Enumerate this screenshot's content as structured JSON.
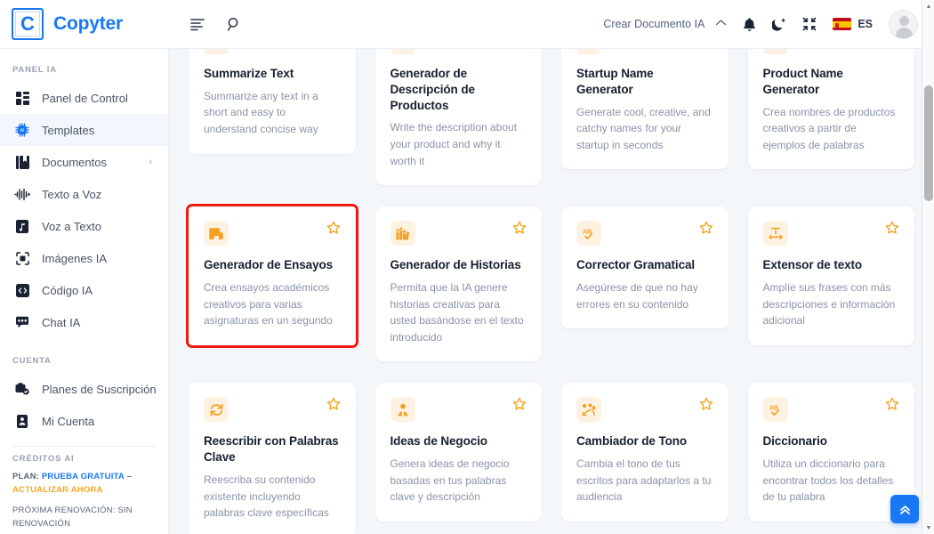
{
  "header": {
    "logo_letter": "C",
    "brand_name": "Copyter",
    "menu_icon": "list-icon",
    "search_icon": "search-icon",
    "create_document_label": "Crear Documento IA",
    "caret": "⌃",
    "notification_icon": "bell-icon",
    "theme_icon": "moon-icon",
    "fullscreen_icon": "fullscreen-icon",
    "lang_code": "ES",
    "avatar_label": "user-avatar"
  },
  "sidebar": {
    "section_panel": "PANEL IA",
    "items": [
      {
        "label": "Panel de Control",
        "icon": "dashboard-icon",
        "active": false,
        "chevron": ""
      },
      {
        "label": "Templates",
        "icon": "ai-chip-icon",
        "active": true,
        "chevron": ""
      },
      {
        "label": "Documentos",
        "icon": "document-icon",
        "active": false,
        "chevron": "›"
      },
      {
        "label": "Texto a Voz",
        "icon": "waveform-icon",
        "active": false,
        "chevron": ""
      },
      {
        "label": "Voz a Texto",
        "icon": "audio-file-icon",
        "active": false,
        "chevron": ""
      },
      {
        "label": "Imágenes IA",
        "icon": "image-scan-icon",
        "active": false,
        "chevron": ""
      },
      {
        "label": "Código IA",
        "icon": "code-icon",
        "active": false,
        "chevron": ""
      },
      {
        "label": "Chat IA",
        "icon": "chat-icon",
        "active": false,
        "chevron": ""
      }
    ],
    "section_account": "CUENTA",
    "account_items": [
      {
        "label": "Planes de Suscripción",
        "icon": "subscription-icon"
      },
      {
        "label": "Mi Cuenta",
        "icon": "account-card-icon"
      }
    ],
    "section_credits": "CRÉDITOS AI",
    "plan_label": "PLAN:",
    "plan_value": "PRUEBA GRATUITA",
    "plan_separator": "–",
    "plan_upgrade": "ACTUALIZAR AHORA",
    "renewal_text": "PRÓXIMA RENOVACIÓN: SIN RENOVACIÓN"
  },
  "main": {
    "scroll_top_label": "scroll-to-top",
    "cards": [
      {
        "title": "Summarize Text",
        "desc": "Summarize any text in a short and easy to understand concise way",
        "icon": "document-text-icon",
        "starred": false,
        "highlight": false
      },
      {
        "title": "Generador de Descripción de Productos",
        "desc": "Write the description about your product and why it worth it",
        "icon": "checklist-icon",
        "starred": false,
        "highlight": false
      },
      {
        "title": "Startup Name Generator",
        "desc": "Generate cool, creative, and catchy names for your startup in seconds",
        "icon": "lightbulb-icon",
        "starred": false,
        "highlight": false
      },
      {
        "title": "Product Name Generator",
        "desc": "Crea nombres de productos creativos a partir de ejemplos de palabras",
        "icon": "product-box-icon",
        "starred": false,
        "highlight": false
      },
      {
        "title": "Generador de Ensayos",
        "desc": "Crea ensayos académicos creativos para varias asignaturas en un segundo",
        "icon": "scroll-icon",
        "starred": false,
        "highlight": true
      },
      {
        "title": "Generador de Historias",
        "desc": "Permita que la IA genere historias creativas para usted basándose en el texto introducido",
        "icon": "books-icon",
        "starred": false,
        "highlight": false
      },
      {
        "title": "Corrector Gramatical",
        "desc": "Asegúrese de que no hay errores en su contenido",
        "icon": "spellcheck-icon",
        "starred": false,
        "highlight": false
      },
      {
        "title": "Extensor de texto",
        "desc": "Amplíe sus frases con más descripciones e información adicional",
        "icon": "expand-text-icon",
        "starred": false,
        "highlight": false
      },
      {
        "title": "Reescribir con Palabras Clave",
        "desc": "Reescriba su contenido existente incluyendo palabras clave específicas",
        "icon": "refresh-icon",
        "starred": false,
        "highlight": false
      },
      {
        "title": "Ideas de Negocio",
        "desc": "Genera ideas de negocio basadas en tus palabras clave y descripción",
        "icon": "person-idea-icon",
        "starred": false,
        "highlight": false
      },
      {
        "title": "Cambiador de Tono",
        "desc": "Cambia el tono de tus escritos para adaptarlos a tu audiencia",
        "icon": "tone-icon",
        "starred": false,
        "highlight": false
      },
      {
        "title": "Diccionario",
        "desc": "Utiliza un diccionario para encontrar todos los detalles de tu palabra",
        "icon": "spellcheck-icon",
        "starred": false,
        "highlight": false
      }
    ]
  }
}
